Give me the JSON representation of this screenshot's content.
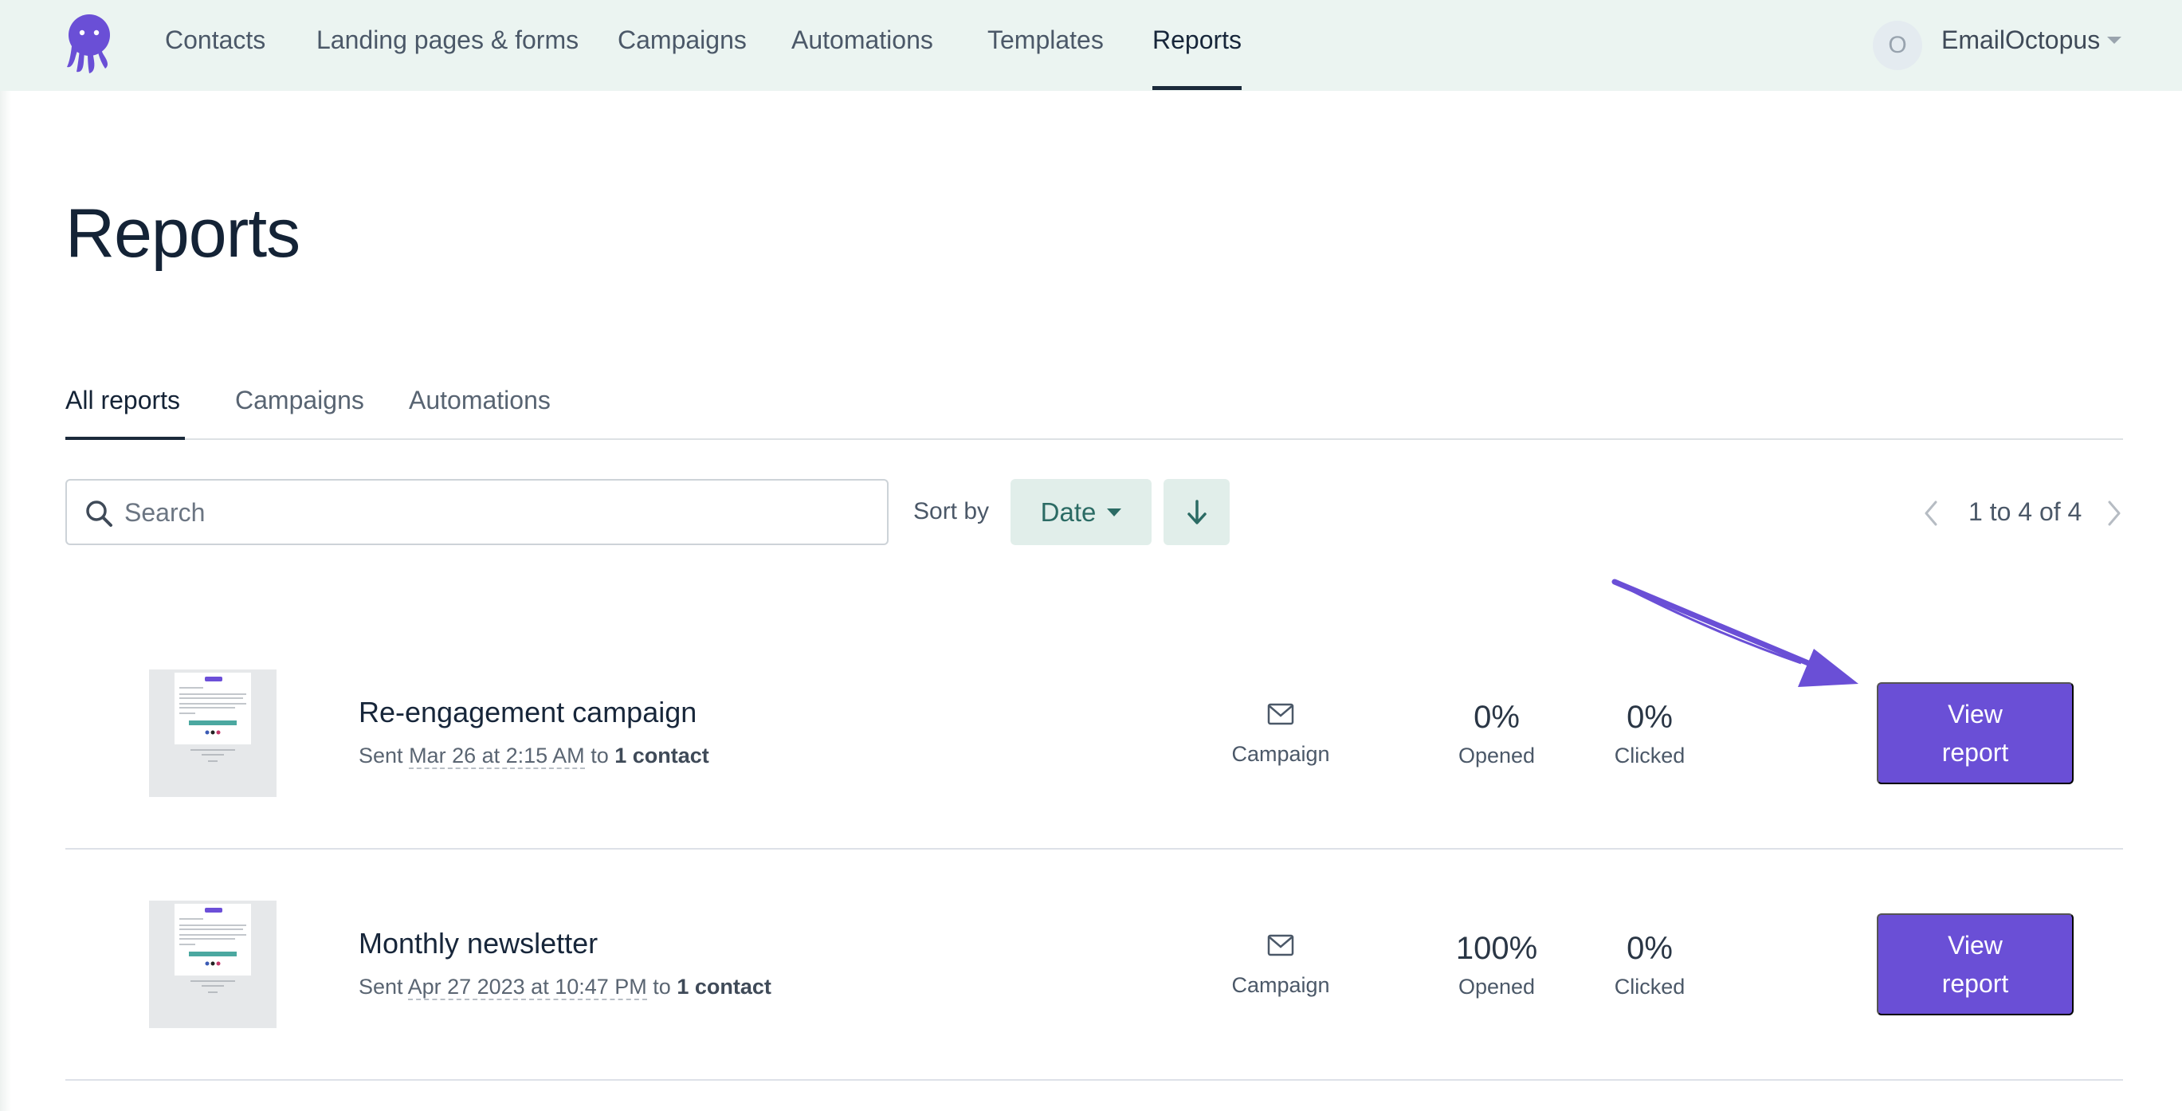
{
  "nav": {
    "items": [
      {
        "label": "Contacts"
      },
      {
        "label": "Landing pages & forms"
      },
      {
        "label": "Campaigns"
      },
      {
        "label": "Automations"
      },
      {
        "label": "Templates"
      },
      {
        "label": "Reports"
      }
    ],
    "active": "Reports",
    "user": {
      "initial": "O",
      "name": "EmailOctopus"
    }
  },
  "page": {
    "title": "Reports"
  },
  "tabs": [
    {
      "label": "All reports"
    },
    {
      "label": "Campaigns"
    },
    {
      "label": "Automations"
    }
  ],
  "active_tab": "All reports",
  "toolbar": {
    "search_placeholder": "Search",
    "sort_label": "Sort by",
    "sort_value": "Date",
    "sort_direction_icon": "arrow-down-icon",
    "pagination": "1 to 4 of 4"
  },
  "reports": [
    {
      "title": "Re-engagement campaign",
      "sent_prefix": "Sent",
      "sent_date": "Mar 26 at 2:15 AM",
      "sent_to": "to",
      "recipients": "1 contact",
      "type": "Campaign",
      "opened_value": "0%",
      "opened_label": "Opened",
      "clicked_value": "0%",
      "clicked_label": "Clicked",
      "button": "View report"
    },
    {
      "title": "Monthly newsletter",
      "sent_prefix": "Sent",
      "sent_date": "Apr 27 2023 at 10:47 PM",
      "sent_to": "to",
      "recipients": "1 contact",
      "type": "Campaign",
      "opened_value": "100%",
      "opened_label": "Opened",
      "clicked_value": "0%",
      "clicked_label": "Clicked",
      "button": "View report"
    }
  ],
  "colors": {
    "brand": "#6a4fd6",
    "nav_bg": "#ebf4f1",
    "sort_bg": "#e1eeea",
    "sort_text": "#2b6b64",
    "heading": "#142336"
  }
}
